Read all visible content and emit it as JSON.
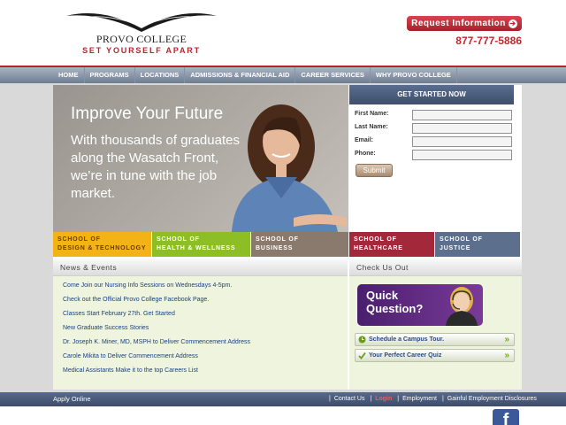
{
  "header": {
    "logo_name": "PROVO COLLEGE",
    "tagline": "SET YOURSELF APART",
    "request_info": "Request Information",
    "phone": "877-777-5886"
  },
  "nav": [
    "HOME",
    "PROGRAMS",
    "LOCATIONS",
    "ADMISSIONS & FINANCIAL AID",
    "CAREER SERVICES",
    "WHY PROVO COLLEGE"
  ],
  "hero": {
    "heading": "Improve Your Future",
    "text": "With thousands of graduates along the Wasatch Front, we’re in tune with the job market."
  },
  "form": {
    "title": "GET STARTED NOW",
    "first_name_label": "First Name:",
    "last_name_label": "Last Name:",
    "email_label": "Email:",
    "phone_label": "Phone:",
    "submit": "Submit"
  },
  "schools": [
    {
      "line1": "SCHOOL OF",
      "line2": "DESIGN & TECHNOLOGY",
      "bg": "#f3b317",
      "fg": "#6b3b00"
    },
    {
      "line1": "SCHOOL OF",
      "line2": "HEALTH & WELLNESS",
      "bg": "#8dbe25",
      "fg": "#ffffff"
    },
    {
      "line1": "SCHOOL OF",
      "line2": "BUSINESS",
      "bg": "#8a7a6e",
      "fg": "#ffffff"
    },
    {
      "line1": "SCHOOL OF",
      "line2": "HEALTHCARE",
      "bg": "#a3283a",
      "fg": "#ffffff"
    },
    {
      "line1": "SCHOOL OF",
      "line2": "JUSTICE",
      "bg": "#5c6f8c",
      "fg": "#ffffff"
    }
  ],
  "news": {
    "title": "News & Events",
    "items": [
      "Come Join our Nursing Info Sessions on Wednesdays 4-5pm.",
      "Check out the Official Provo College Facebook Page.",
      "Classes Start February 27th. Get Started",
      "New Graduate Success Stories",
      "Dr. Joseph K. Miner, MD, MSPH to Deliver Commencement Address",
      "Carole Mikita to Deliver Commencement Address",
      "Medical Assistants Make it to the top Careers List"
    ]
  },
  "check": {
    "title": "Check Us Out",
    "quick_question": "Quick Question?",
    "tour": "Schedule a Campus Tour.",
    "quiz": "Your Perfect Career Quiz"
  },
  "footer": {
    "apply": "Apply Online",
    "contact": "Contact Us",
    "login": "Login",
    "employment": "Employment",
    "gainful": "Gainful Employment Disclosures"
  },
  "colors": {
    "brand_red": "#b8232f",
    "nav_blue": "#6f7d92",
    "panel_green": "#eef4de"
  }
}
